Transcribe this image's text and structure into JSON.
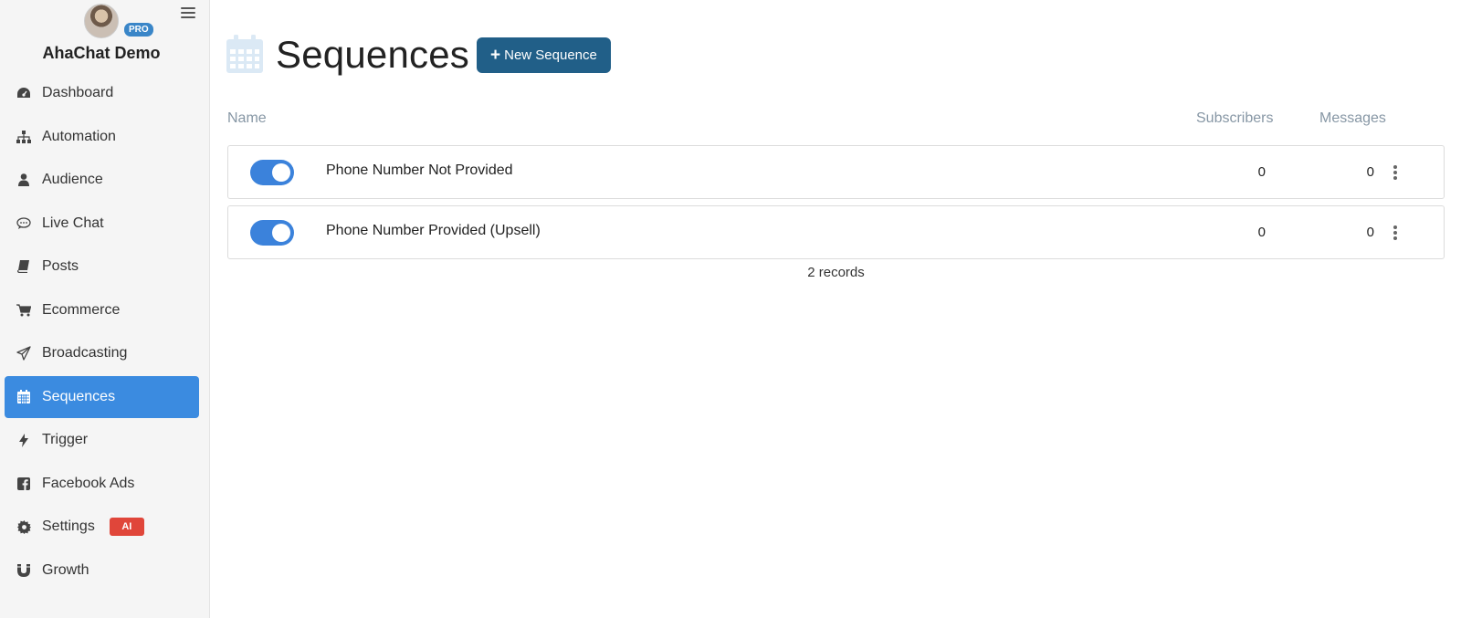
{
  "sidebar": {
    "account_name": "AhaChat Demo",
    "badge": "PRO",
    "items": [
      {
        "label": "Dashboard",
        "icon": "dashboard-icon",
        "active": false
      },
      {
        "label": "Automation",
        "icon": "sitemap-icon",
        "active": false
      },
      {
        "label": "Audience",
        "icon": "user-icon",
        "active": false
      },
      {
        "label": "Live Chat",
        "icon": "chat-bubble-icon",
        "active": false
      },
      {
        "label": "Posts",
        "icon": "book-icon",
        "active": false
      },
      {
        "label": "Ecommerce",
        "icon": "cart-icon",
        "active": false
      },
      {
        "label": "Broadcasting",
        "icon": "paper-plane-icon",
        "active": false
      },
      {
        "label": "Sequences",
        "icon": "calendar-icon",
        "active": true
      },
      {
        "label": "Trigger",
        "icon": "bolt-icon",
        "active": false
      },
      {
        "label": "Facebook Ads",
        "icon": "facebook-icon",
        "active": false
      },
      {
        "label": "Settings",
        "icon": "gear-icon",
        "active": false,
        "badge": "AI"
      },
      {
        "label": "Growth",
        "icon": "magnet-icon",
        "active": false
      }
    ]
  },
  "header": {
    "title": "Sequences",
    "new_button_label": "New Sequence"
  },
  "table": {
    "columns": {
      "name": "Name",
      "subscribers": "Subscribers",
      "messages": "Messages"
    },
    "rows": [
      {
        "enabled": true,
        "name": "Phone Number Not Provided",
        "subscribers": "0",
        "messages": "0"
      },
      {
        "enabled": true,
        "name": "Phone Number Provided (Upsell)",
        "subscribers": "0",
        "messages": "0"
      }
    ],
    "records_label": "2 records"
  },
  "colors": {
    "accent": "#3b8be0",
    "primary_button": "#215f88",
    "toggle_on": "#3b82db",
    "ai_badge": "#e0463a",
    "pro_badge": "#3a86c8"
  }
}
